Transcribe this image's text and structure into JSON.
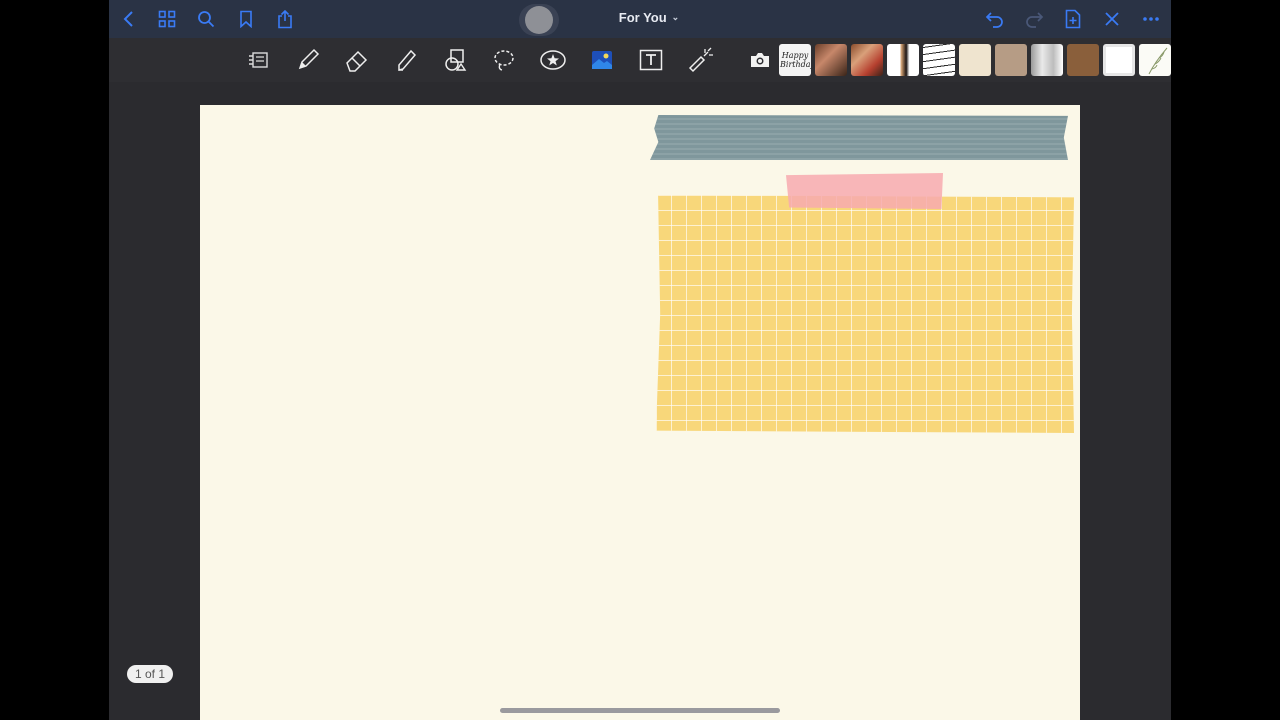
{
  "header": {
    "title": "For You",
    "accent": "#3a7bf5"
  },
  "toolbar": {
    "tools": [
      "page-layout-icon",
      "pen-icon",
      "eraser-icon",
      "highlighter-icon",
      "shapes-icon",
      "lasso-icon",
      "elements-icon",
      "image-icon",
      "text-icon",
      "laser-pointer-icon",
      "camera-icon"
    ]
  },
  "stickers": {
    "first_label": "Happy Birthday"
  },
  "page": {
    "indicator": "1 of 1",
    "background": "#fbf8e8"
  }
}
